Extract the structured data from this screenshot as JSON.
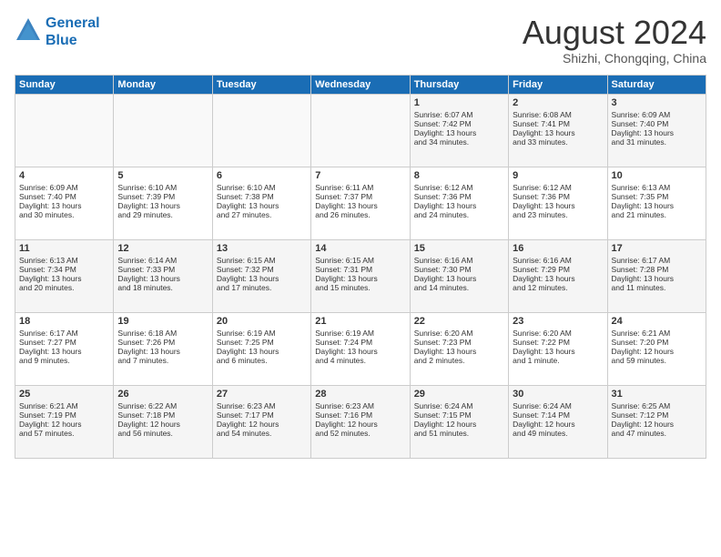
{
  "logo": {
    "line1": "General",
    "line2": "Blue"
  },
  "title": "August 2024",
  "subtitle": "Shizhi, Chongqing, China",
  "days_of_week": [
    "Sunday",
    "Monday",
    "Tuesday",
    "Wednesday",
    "Thursday",
    "Friday",
    "Saturday"
  ],
  "weeks": [
    [
      {
        "day": "",
        "content": ""
      },
      {
        "day": "",
        "content": ""
      },
      {
        "day": "",
        "content": ""
      },
      {
        "day": "",
        "content": ""
      },
      {
        "day": "1",
        "content": "Sunrise: 6:07 AM\nSunset: 7:42 PM\nDaylight: 13 hours\nand 34 minutes."
      },
      {
        "day": "2",
        "content": "Sunrise: 6:08 AM\nSunset: 7:41 PM\nDaylight: 13 hours\nand 33 minutes."
      },
      {
        "day": "3",
        "content": "Sunrise: 6:09 AM\nSunset: 7:40 PM\nDaylight: 13 hours\nand 31 minutes."
      }
    ],
    [
      {
        "day": "4",
        "content": "Sunrise: 6:09 AM\nSunset: 7:40 PM\nDaylight: 13 hours\nand 30 minutes."
      },
      {
        "day": "5",
        "content": "Sunrise: 6:10 AM\nSunset: 7:39 PM\nDaylight: 13 hours\nand 29 minutes."
      },
      {
        "day": "6",
        "content": "Sunrise: 6:10 AM\nSunset: 7:38 PM\nDaylight: 13 hours\nand 27 minutes."
      },
      {
        "day": "7",
        "content": "Sunrise: 6:11 AM\nSunset: 7:37 PM\nDaylight: 13 hours\nand 26 minutes."
      },
      {
        "day": "8",
        "content": "Sunrise: 6:12 AM\nSunset: 7:36 PM\nDaylight: 13 hours\nand 24 minutes."
      },
      {
        "day": "9",
        "content": "Sunrise: 6:12 AM\nSunset: 7:36 PM\nDaylight: 13 hours\nand 23 minutes."
      },
      {
        "day": "10",
        "content": "Sunrise: 6:13 AM\nSunset: 7:35 PM\nDaylight: 13 hours\nand 21 minutes."
      }
    ],
    [
      {
        "day": "11",
        "content": "Sunrise: 6:13 AM\nSunset: 7:34 PM\nDaylight: 13 hours\nand 20 minutes."
      },
      {
        "day": "12",
        "content": "Sunrise: 6:14 AM\nSunset: 7:33 PM\nDaylight: 13 hours\nand 18 minutes."
      },
      {
        "day": "13",
        "content": "Sunrise: 6:15 AM\nSunset: 7:32 PM\nDaylight: 13 hours\nand 17 minutes."
      },
      {
        "day": "14",
        "content": "Sunrise: 6:15 AM\nSunset: 7:31 PM\nDaylight: 13 hours\nand 15 minutes."
      },
      {
        "day": "15",
        "content": "Sunrise: 6:16 AM\nSunset: 7:30 PM\nDaylight: 13 hours\nand 14 minutes."
      },
      {
        "day": "16",
        "content": "Sunrise: 6:16 AM\nSunset: 7:29 PM\nDaylight: 13 hours\nand 12 minutes."
      },
      {
        "day": "17",
        "content": "Sunrise: 6:17 AM\nSunset: 7:28 PM\nDaylight: 13 hours\nand 11 minutes."
      }
    ],
    [
      {
        "day": "18",
        "content": "Sunrise: 6:17 AM\nSunset: 7:27 PM\nDaylight: 13 hours\nand 9 minutes."
      },
      {
        "day": "19",
        "content": "Sunrise: 6:18 AM\nSunset: 7:26 PM\nDaylight: 13 hours\nand 7 minutes."
      },
      {
        "day": "20",
        "content": "Sunrise: 6:19 AM\nSunset: 7:25 PM\nDaylight: 13 hours\nand 6 minutes."
      },
      {
        "day": "21",
        "content": "Sunrise: 6:19 AM\nSunset: 7:24 PM\nDaylight: 13 hours\nand 4 minutes."
      },
      {
        "day": "22",
        "content": "Sunrise: 6:20 AM\nSunset: 7:23 PM\nDaylight: 13 hours\nand 2 minutes."
      },
      {
        "day": "23",
        "content": "Sunrise: 6:20 AM\nSunset: 7:22 PM\nDaylight: 13 hours\nand 1 minute."
      },
      {
        "day": "24",
        "content": "Sunrise: 6:21 AM\nSunset: 7:20 PM\nDaylight: 12 hours\nand 59 minutes."
      }
    ],
    [
      {
        "day": "25",
        "content": "Sunrise: 6:21 AM\nSunset: 7:19 PM\nDaylight: 12 hours\nand 57 minutes."
      },
      {
        "day": "26",
        "content": "Sunrise: 6:22 AM\nSunset: 7:18 PM\nDaylight: 12 hours\nand 56 minutes."
      },
      {
        "day": "27",
        "content": "Sunrise: 6:23 AM\nSunset: 7:17 PM\nDaylight: 12 hours\nand 54 minutes."
      },
      {
        "day": "28",
        "content": "Sunrise: 6:23 AM\nSunset: 7:16 PM\nDaylight: 12 hours\nand 52 minutes."
      },
      {
        "day": "29",
        "content": "Sunrise: 6:24 AM\nSunset: 7:15 PM\nDaylight: 12 hours\nand 51 minutes."
      },
      {
        "day": "30",
        "content": "Sunrise: 6:24 AM\nSunset: 7:14 PM\nDaylight: 12 hours\nand 49 minutes."
      },
      {
        "day": "31",
        "content": "Sunrise: 6:25 AM\nSunset: 7:12 PM\nDaylight: 12 hours\nand 47 minutes."
      }
    ]
  ]
}
